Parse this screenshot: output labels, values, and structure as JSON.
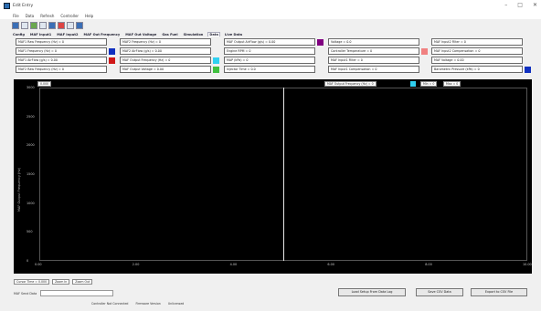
{
  "window": {
    "title": "Edit Entry",
    "controls": [
      "–",
      "□",
      "✕"
    ]
  },
  "menu": [
    "File",
    "Data",
    "Refresh",
    "Controller",
    "Help"
  ],
  "tabs": [
    {
      "label": "Config"
    },
    {
      "label": "MAF Input1"
    },
    {
      "label": "MAF Input2"
    },
    {
      "label": "MAF Out Frequency"
    },
    {
      "label": "MAF Out Voltage"
    },
    {
      "label": "Gas Fuel"
    },
    {
      "label": "Simulation"
    },
    {
      "label": "Data",
      "active": true
    },
    {
      "label": "Live Data"
    }
  ],
  "params": {
    "col1": [
      {
        "text": "MAF1 Raw Frequency (Hz) = 0",
        "color": ""
      },
      {
        "text": "MAF1 Frequency (Hz) = 0",
        "color": "#1030c0"
      },
      {
        "text": "MAF1 AirFlow (g/s) = 0.00",
        "color": "#d01818"
      },
      {
        "text": "MAF2 Raw Frequency (Hz) = 0",
        "color": ""
      }
    ],
    "col2": [
      {
        "text": "MAF2 Frequency (Hz) = 0",
        "color": ""
      },
      {
        "text": "MAF2 AirFlow (g/s) = 0.00",
        "color": ""
      },
      {
        "text": "MAF Output Frequency (Hz) = 0",
        "color": "#30d0f0"
      },
      {
        "text": "MAF Output Voltage = 0.00",
        "color": "#40c040"
      }
    ],
    "col3": [
      {
        "text": "MAF Output AirFlow (g/s) = 0.00",
        "color": "#800080"
      },
      {
        "text": "Engine RPM = 0",
        "color": ""
      },
      {
        "text": "MAP (kPa) = 0",
        "color": ""
      },
      {
        "text": "Injector Time = 0.0",
        "color": ""
      }
    ],
    "col4": [
      {
        "text": "Voltage = 0.0",
        "color": ""
      },
      {
        "text": "Controller Temperature = 0",
        "color": "#f08080"
      },
      {
        "text": "MAF Input1 Filter = 0",
        "color": ""
      },
      {
        "text": "MAF Input1 Compensation = 0",
        "color": ""
      }
    ],
    "col5": [
      {
        "text": "MAF Input2 Filter = 0",
        "color": ""
      },
      {
        "text": "MAF Input2 Compensation = 0",
        "color": ""
      },
      {
        "text": "MAF Voltage = 0.00",
        "color": ""
      },
      {
        "text": "Barometric Pressure (kPa) = 0",
        "color": "#1030c0"
      }
    ]
  },
  "plot": {
    "top_left": "0.000",
    "top_series": "MAF Output Frequency (Hz) = 0",
    "min_label": "Min = 0",
    "max_label": "Max = 0",
    "y_axis_label": "MAF Output Frequency (Hz)",
    "y_ticks": [
      "3000",
      "2500",
      "2000",
      "1500",
      "1000",
      "500",
      "0"
    ],
    "x_ticks": [
      "0.00",
      "2.00",
      "4.00",
      "6.00",
      "8.00",
      "10.00"
    ],
    "cursor_fraction": 0.5
  },
  "bottom": {
    "cursor_time": "Cursor Time = 0.000",
    "zoom": "Zoom In",
    "zoom_out": "Zoom Out",
    "send_label": "MAF Send Data",
    "load_button": "Load Setup From Data Log",
    "save_csv": "Save CSV Data",
    "export_button": "Export to CSV File"
  },
  "status": [
    "Controller Not Connected",
    "Firmware Version",
    "Unlicensed"
  ]
}
